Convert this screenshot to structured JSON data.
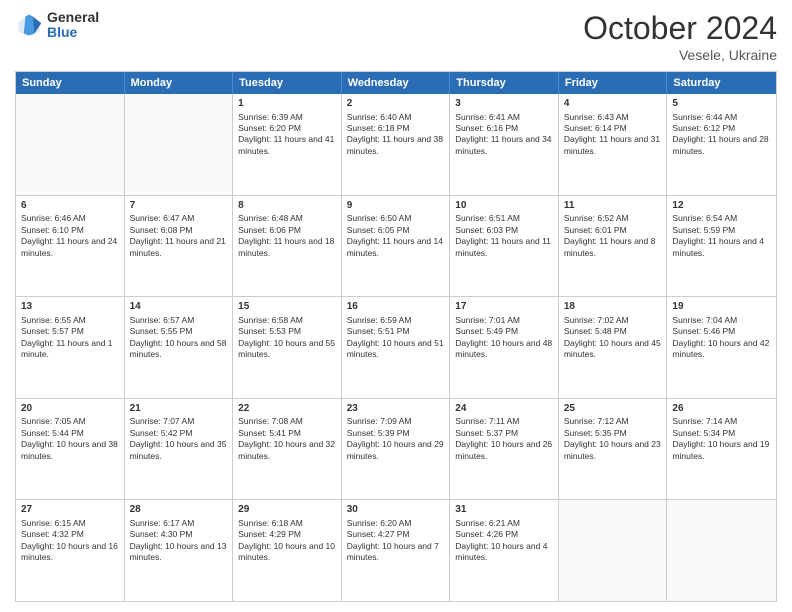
{
  "logo": {
    "general": "General",
    "blue": "Blue"
  },
  "header": {
    "month": "October 2024",
    "location": "Vesele, Ukraine"
  },
  "days": [
    "Sunday",
    "Monday",
    "Tuesday",
    "Wednesday",
    "Thursday",
    "Friday",
    "Saturday"
  ],
  "rows": [
    [
      {
        "day": "",
        "empty": true
      },
      {
        "day": "",
        "empty": true
      },
      {
        "day": "1",
        "sunrise": "Sunrise: 6:39 AM",
        "sunset": "Sunset: 6:20 PM",
        "daylight": "Daylight: 11 hours and 41 minutes."
      },
      {
        "day": "2",
        "sunrise": "Sunrise: 6:40 AM",
        "sunset": "Sunset: 6:18 PM",
        "daylight": "Daylight: 11 hours and 38 minutes."
      },
      {
        "day": "3",
        "sunrise": "Sunrise: 6:41 AM",
        "sunset": "Sunset: 6:16 PM",
        "daylight": "Daylight: 11 hours and 34 minutes."
      },
      {
        "day": "4",
        "sunrise": "Sunrise: 6:43 AM",
        "sunset": "Sunset: 6:14 PM",
        "daylight": "Daylight: 11 hours and 31 minutes."
      },
      {
        "day": "5",
        "sunrise": "Sunrise: 6:44 AM",
        "sunset": "Sunset: 6:12 PM",
        "daylight": "Daylight: 11 hours and 28 minutes."
      }
    ],
    [
      {
        "day": "6",
        "sunrise": "Sunrise: 6:46 AM",
        "sunset": "Sunset: 6:10 PM",
        "daylight": "Daylight: 11 hours and 24 minutes."
      },
      {
        "day": "7",
        "sunrise": "Sunrise: 6:47 AM",
        "sunset": "Sunset: 6:08 PM",
        "daylight": "Daylight: 11 hours and 21 minutes."
      },
      {
        "day": "8",
        "sunrise": "Sunrise: 6:48 AM",
        "sunset": "Sunset: 6:06 PM",
        "daylight": "Daylight: 11 hours and 18 minutes."
      },
      {
        "day": "9",
        "sunrise": "Sunrise: 6:50 AM",
        "sunset": "Sunset: 6:05 PM",
        "daylight": "Daylight: 11 hours and 14 minutes."
      },
      {
        "day": "10",
        "sunrise": "Sunrise: 6:51 AM",
        "sunset": "Sunset: 6:03 PM",
        "daylight": "Daylight: 11 hours and 11 minutes."
      },
      {
        "day": "11",
        "sunrise": "Sunrise: 6:52 AM",
        "sunset": "Sunset: 6:01 PM",
        "daylight": "Daylight: 11 hours and 8 minutes."
      },
      {
        "day": "12",
        "sunrise": "Sunrise: 6:54 AM",
        "sunset": "Sunset: 5:59 PM",
        "daylight": "Daylight: 11 hours and 4 minutes."
      }
    ],
    [
      {
        "day": "13",
        "sunrise": "Sunrise: 6:55 AM",
        "sunset": "Sunset: 5:57 PM",
        "daylight": "Daylight: 11 hours and 1 minute."
      },
      {
        "day": "14",
        "sunrise": "Sunrise: 6:57 AM",
        "sunset": "Sunset: 5:55 PM",
        "daylight": "Daylight: 10 hours and 58 minutes."
      },
      {
        "day": "15",
        "sunrise": "Sunrise: 6:58 AM",
        "sunset": "Sunset: 5:53 PM",
        "daylight": "Daylight: 10 hours and 55 minutes."
      },
      {
        "day": "16",
        "sunrise": "Sunrise: 6:59 AM",
        "sunset": "Sunset: 5:51 PM",
        "daylight": "Daylight: 10 hours and 51 minutes."
      },
      {
        "day": "17",
        "sunrise": "Sunrise: 7:01 AM",
        "sunset": "Sunset: 5:49 PM",
        "daylight": "Daylight: 10 hours and 48 minutes."
      },
      {
        "day": "18",
        "sunrise": "Sunrise: 7:02 AM",
        "sunset": "Sunset: 5:48 PM",
        "daylight": "Daylight: 10 hours and 45 minutes."
      },
      {
        "day": "19",
        "sunrise": "Sunrise: 7:04 AM",
        "sunset": "Sunset: 5:46 PM",
        "daylight": "Daylight: 10 hours and 42 minutes."
      }
    ],
    [
      {
        "day": "20",
        "sunrise": "Sunrise: 7:05 AM",
        "sunset": "Sunset: 5:44 PM",
        "daylight": "Daylight: 10 hours and 38 minutes."
      },
      {
        "day": "21",
        "sunrise": "Sunrise: 7:07 AM",
        "sunset": "Sunset: 5:42 PM",
        "daylight": "Daylight: 10 hours and 35 minutes."
      },
      {
        "day": "22",
        "sunrise": "Sunrise: 7:08 AM",
        "sunset": "Sunset: 5:41 PM",
        "daylight": "Daylight: 10 hours and 32 minutes."
      },
      {
        "day": "23",
        "sunrise": "Sunrise: 7:09 AM",
        "sunset": "Sunset: 5:39 PM",
        "daylight": "Daylight: 10 hours and 29 minutes."
      },
      {
        "day": "24",
        "sunrise": "Sunrise: 7:11 AM",
        "sunset": "Sunset: 5:37 PM",
        "daylight": "Daylight: 10 hours and 26 minutes."
      },
      {
        "day": "25",
        "sunrise": "Sunrise: 7:12 AM",
        "sunset": "Sunset: 5:35 PM",
        "daylight": "Daylight: 10 hours and 23 minutes."
      },
      {
        "day": "26",
        "sunrise": "Sunrise: 7:14 AM",
        "sunset": "Sunset: 5:34 PM",
        "daylight": "Daylight: 10 hours and 19 minutes."
      }
    ],
    [
      {
        "day": "27",
        "sunrise": "Sunrise: 6:15 AM",
        "sunset": "Sunset: 4:32 PM",
        "daylight": "Daylight: 10 hours and 16 minutes."
      },
      {
        "day": "28",
        "sunrise": "Sunrise: 6:17 AM",
        "sunset": "Sunset: 4:30 PM",
        "daylight": "Daylight: 10 hours and 13 minutes."
      },
      {
        "day": "29",
        "sunrise": "Sunrise: 6:18 AM",
        "sunset": "Sunset: 4:29 PM",
        "daylight": "Daylight: 10 hours and 10 minutes."
      },
      {
        "day": "30",
        "sunrise": "Sunrise: 6:20 AM",
        "sunset": "Sunset: 4:27 PM",
        "daylight": "Daylight: 10 hours and 7 minutes."
      },
      {
        "day": "31",
        "sunrise": "Sunrise: 6:21 AM",
        "sunset": "Sunset: 4:26 PM",
        "daylight": "Daylight: 10 hours and 4 minutes."
      },
      {
        "day": "",
        "empty": true
      },
      {
        "day": "",
        "empty": true
      }
    ]
  ]
}
